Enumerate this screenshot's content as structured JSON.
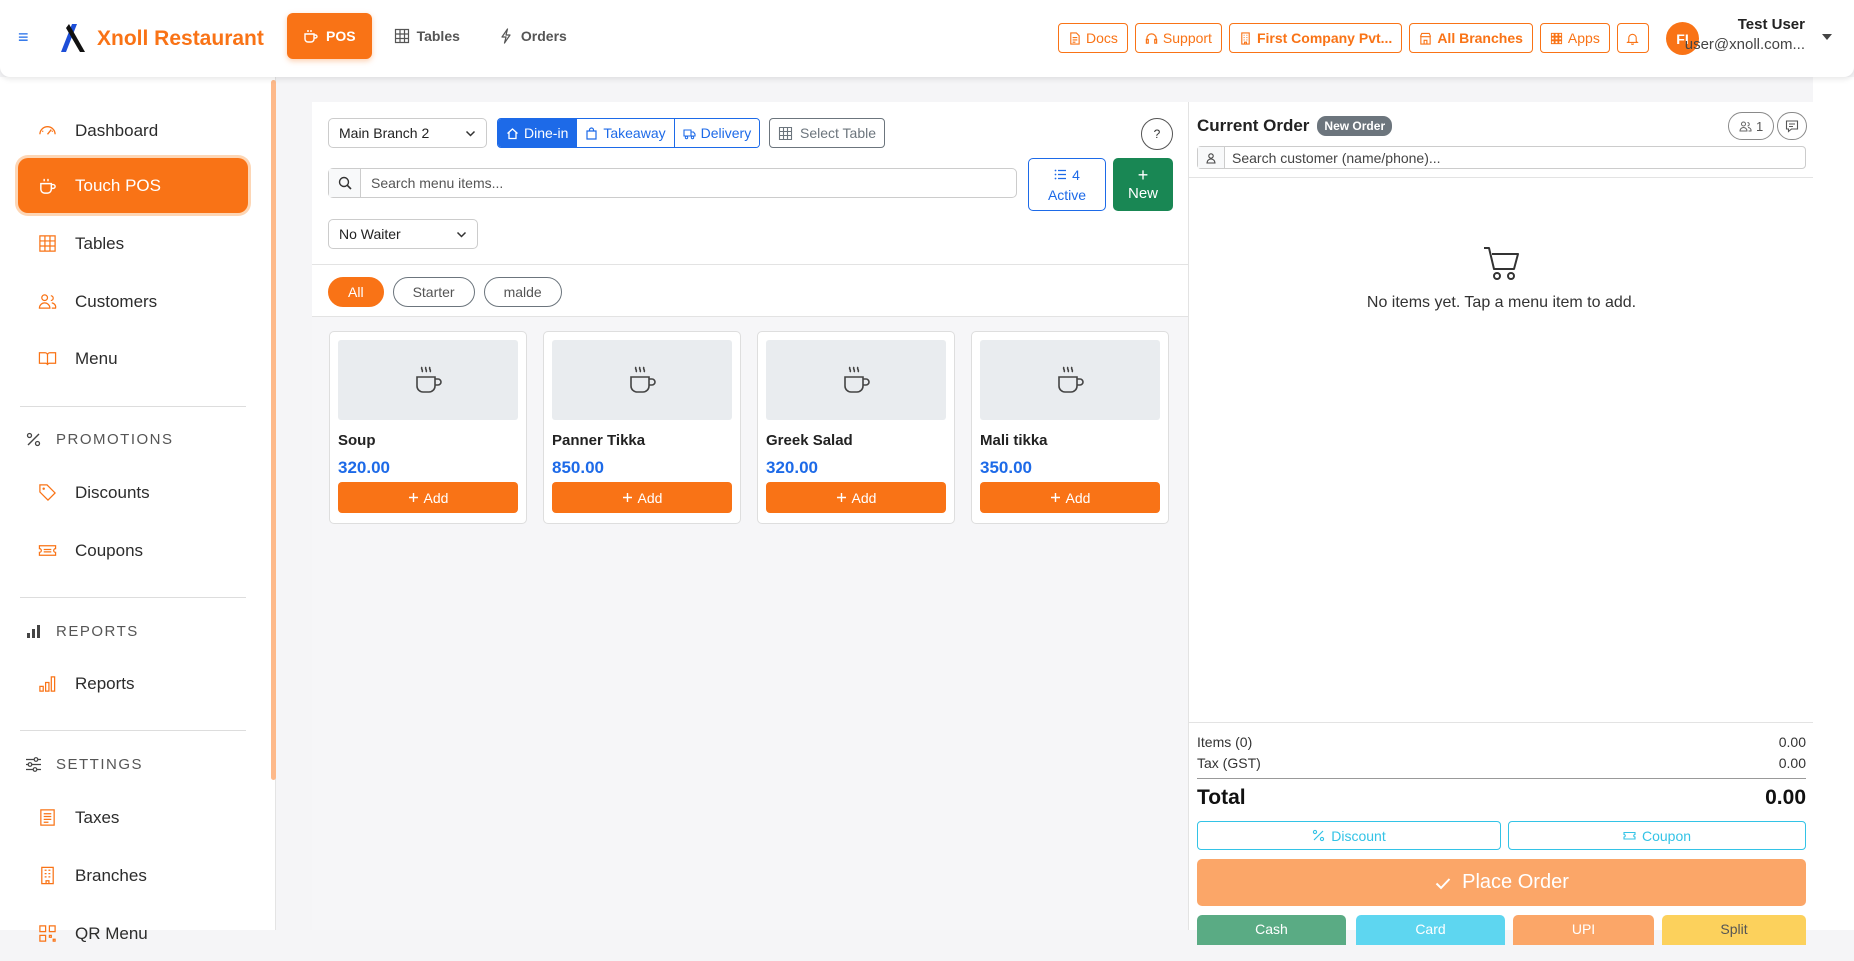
{
  "brand": {
    "name": "Xnoll Restaurant"
  },
  "topnav": [
    {
      "label": "POS",
      "icon": "cup-icon",
      "active": true
    },
    {
      "label": "Tables",
      "icon": "grid-icon",
      "active": false
    },
    {
      "label": "Orders",
      "icon": "lightning-icon",
      "active": false
    }
  ],
  "top_actions": {
    "docs": "Docs",
    "support": "Support",
    "company": "First Company Pvt...",
    "branches": "All Branches",
    "apps": "Apps"
  },
  "user": {
    "initials": "FI",
    "name": "Test User",
    "email": "user@xnoll.com..."
  },
  "sidebar": {
    "items": [
      {
        "label": "Dashboard"
      },
      {
        "label": "Touch POS"
      },
      {
        "label": "Tables"
      },
      {
        "label": "Customers"
      },
      {
        "label": "Menu"
      }
    ],
    "promotions": {
      "title": "PROMOTIONS",
      "items": [
        {
          "label": "Discounts"
        },
        {
          "label": "Coupons"
        }
      ]
    },
    "reports": {
      "title": "REPORTS",
      "items": [
        {
          "label": "Reports"
        }
      ]
    },
    "settings": {
      "title": "SETTINGS",
      "items": [
        {
          "label": "Taxes"
        },
        {
          "label": "Branches"
        },
        {
          "label": "QR Menu"
        }
      ]
    }
  },
  "pos": {
    "branch": "Main Branch 2",
    "order_types": [
      {
        "label": "Dine-in"
      },
      {
        "label": "Takeaway"
      },
      {
        "label": "Delivery"
      }
    ],
    "select_table": "Select Table",
    "help": "?",
    "search_placeholder": "Search menu items...",
    "active_count": "4",
    "active_label": "Active",
    "new_label": "New",
    "waiter": "No Waiter",
    "categories": [
      {
        "label": "All"
      },
      {
        "label": "Starter"
      },
      {
        "label": "malde"
      }
    ],
    "items": [
      {
        "name": "Soup",
        "price": "320.00",
        "add": "Add"
      },
      {
        "name": "Panner Tikka",
        "price": "850.00",
        "add": "Add"
      },
      {
        "name": "Greek Salad",
        "price": "320.00",
        "add": "Add"
      },
      {
        "name": "Mali tikka",
        "price": "350.00",
        "add": "Add"
      }
    ]
  },
  "order": {
    "title": "Current Order",
    "badge": "New Order",
    "guests": "1",
    "customer_placeholder": "Search customer (name/phone)...",
    "empty_message": "No items yet. Tap a menu item to add.",
    "items_label": "Items (0)",
    "items_value": "0.00",
    "tax_label": "Tax (GST)",
    "tax_value": "0.00",
    "total_label": "Total",
    "total_value": "0.00",
    "discount": "Discount",
    "coupon": "Coupon",
    "place_order": "Place Order",
    "payments": [
      {
        "label": "Cash",
        "color": "#5aab84"
      },
      {
        "label": "Card",
        "color": "#5ed6f0"
      },
      {
        "label": "UPI",
        "color": "#fba668"
      },
      {
        "label": "Split",
        "color": "#fcd15c"
      }
    ]
  },
  "colors": {
    "accent": "#f97316",
    "primary": "#1d6ae8",
    "success": "#198754"
  }
}
